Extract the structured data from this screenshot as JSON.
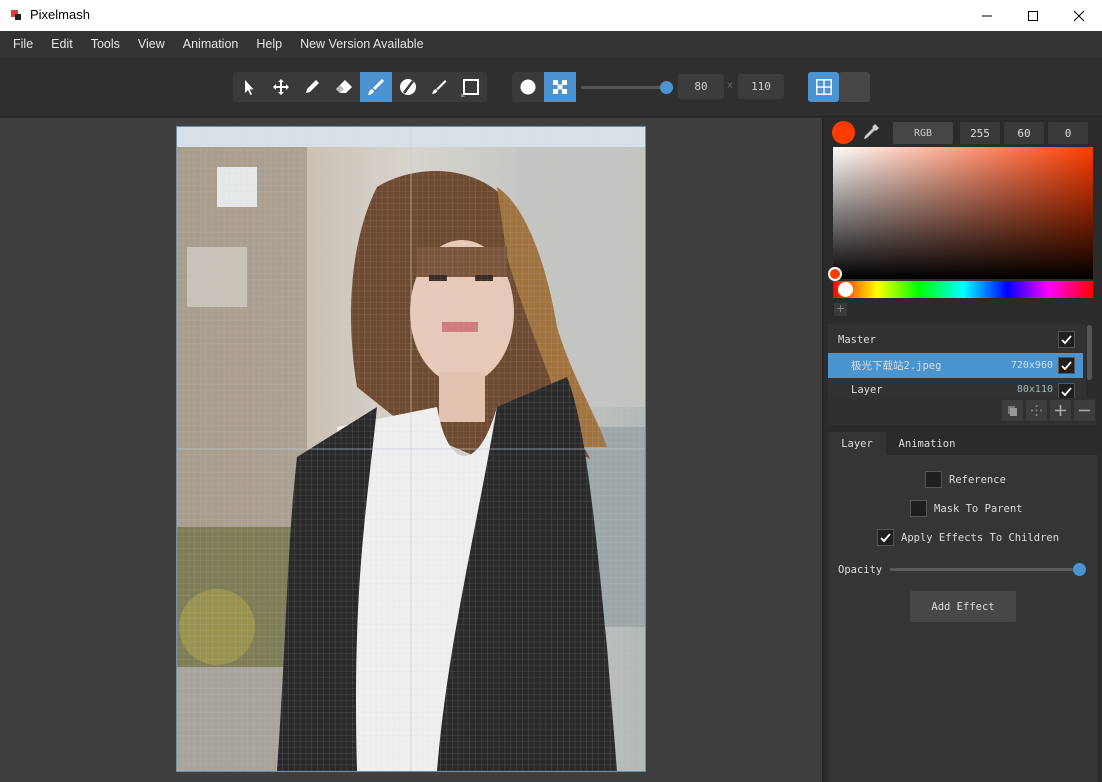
{
  "window": {
    "title": "Pixelmash",
    "controls": [
      "minimize",
      "maximize",
      "close"
    ]
  },
  "menu": {
    "items": [
      "File",
      "Edit",
      "Tools",
      "View",
      "Animation",
      "Help",
      "New Version Available"
    ]
  },
  "toolbar": {
    "tools": [
      {
        "icon": "pointer-icon",
        "active": false
      },
      {
        "icon": "move-icon",
        "active": false
      },
      {
        "icon": "pencil-icon",
        "active": false
      },
      {
        "icon": "eraser-icon",
        "active": false
      },
      {
        "icon": "brush-icon",
        "active": true
      },
      {
        "icon": "no-paint-icon",
        "active": false
      },
      {
        "icon": "smudge-icon",
        "active": false
      },
      {
        "icon": "rectangle-icon",
        "active": false
      }
    ],
    "pixel_modes": [
      {
        "icon": "circle-dot-icon",
        "active": false
      },
      {
        "icon": "checker-icon",
        "active": true
      }
    ],
    "size_slider": 1.0,
    "width": "80",
    "height": "110",
    "separator": "x",
    "view_modes": [
      {
        "icon": "grid-view-icon",
        "active": true
      },
      {
        "icon": "single-view-icon",
        "active": false
      }
    ]
  },
  "color": {
    "current": "#ff3c00",
    "mode_label": "RGB",
    "r": "255",
    "g": "60",
    "b": "0",
    "hue_position": 0.04,
    "add_swatch": "+"
  },
  "layers": {
    "rows": [
      {
        "name": "Master",
        "size": "",
        "visible": true,
        "selected": false
      },
      {
        "name": "极光下载站2.jpeg",
        "size": "720x960",
        "visible": true,
        "selected": true
      },
      {
        "name": "Layer",
        "size": "80x110",
        "visible": true,
        "selected": false
      }
    ]
  },
  "tabs": {
    "layer": "Layer",
    "animation": "Animation"
  },
  "properties": {
    "reference": "Reference",
    "mask_to_parent": "Mask To Parent",
    "apply_effects": "Apply Effects To Children",
    "reference_checked": false,
    "mask_checked": false,
    "apply_checked": true,
    "opacity_label": "Opacity",
    "opacity_value": 1.0,
    "add_effect": "Add Effect"
  },
  "colors": {
    "accent": "#4d93cf",
    "bg_dark": "#2b2b2b",
    "canvas_bg": "#3f3f3f"
  }
}
